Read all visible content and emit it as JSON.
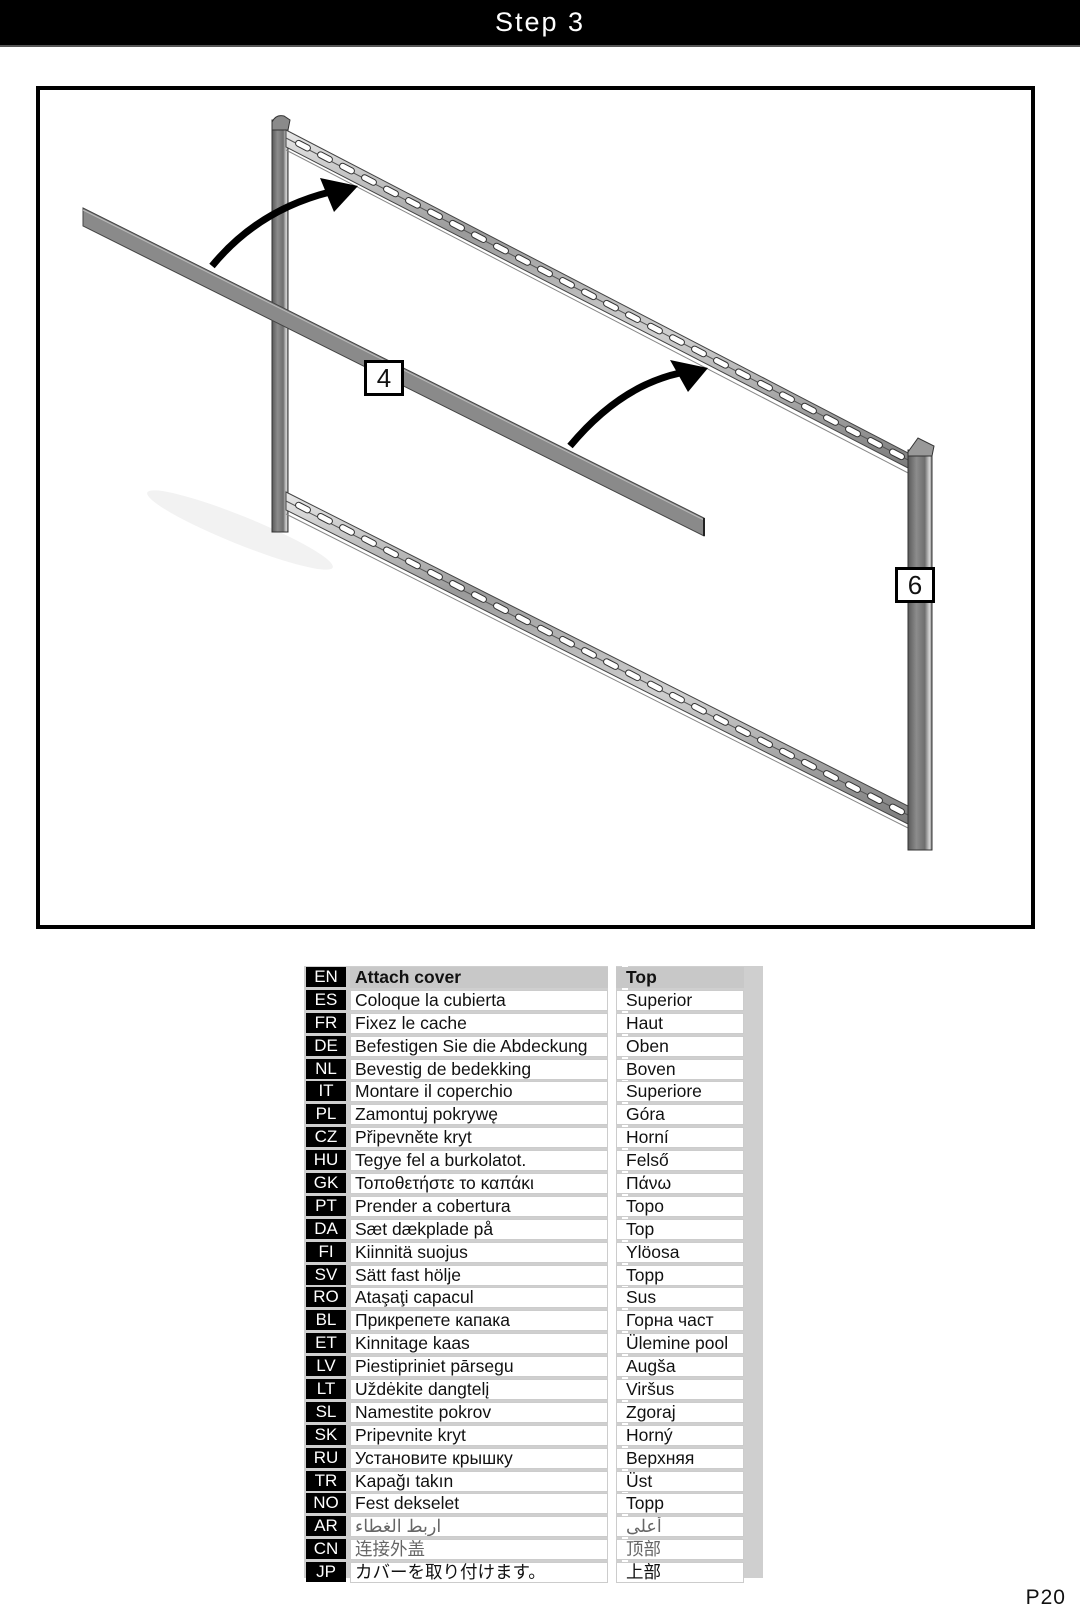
{
  "header": {
    "title": "Step 3"
  },
  "figure": {
    "callouts": [
      {
        "label": "4",
        "part": "cover"
      },
      {
        "label": "6",
        "part": "frame"
      }
    ],
    "icons": [
      "curved-arrow-icon",
      "curved-arrow-icon"
    ]
  },
  "translations": [
    {
      "code": "EN",
      "action": "Attach cover",
      "position": "Top"
    },
    {
      "code": "ES",
      "action": "Coloque la cubierta",
      "position": "Superior"
    },
    {
      "code": "FR",
      "action": "Fixez le cache",
      "position": "Haut"
    },
    {
      "code": "DE",
      "action": "Befestigen Sie die Abdeckung",
      "position": "Oben"
    },
    {
      "code": "NL",
      "action": "Bevestig de bedekking",
      "position": "Boven"
    },
    {
      "code": "IT",
      "action": "Montare il coperchio",
      "position": "Superiore"
    },
    {
      "code": "PL",
      "action": "Zamontuj pokrywę",
      "position": "Góra"
    },
    {
      "code": "CZ",
      "action": "Připevněte kryt",
      "position": "Horní"
    },
    {
      "code": "HU",
      "action": "Tegye fel a burkolatot.",
      "position": "Felső"
    },
    {
      "code": "GK",
      "action": "Τοποθετήστε το καπάκι",
      "position": "Πάνω"
    },
    {
      "code": "PT",
      "action": "Prender a cobertura",
      "position": "Topo"
    },
    {
      "code": "DA",
      "action": "Sæt dækplade på",
      "position": "Top"
    },
    {
      "code": "FI",
      "action": "Kiinnitä suojus",
      "position": "Ylöosa"
    },
    {
      "code": "SV",
      "action": "Sätt fast hölje",
      "position": "Topp"
    },
    {
      "code": "RO",
      "action": "Ataşaţi capacul",
      "position": "Sus"
    },
    {
      "code": "BL",
      "action": "Прикрепете капака",
      "position": "Горна част"
    },
    {
      "code": "ET",
      "action": "Kinnitage kaas",
      "position": "Ülemine pool"
    },
    {
      "code": "LV",
      "action": "Piestipriniet pārsegu",
      "position": "Augša"
    },
    {
      "code": "LT",
      "action": "Uždėkite dangtelį",
      "position": "Viršus"
    },
    {
      "code": "SL",
      "action": "Namestite pokrov",
      "position": "Zgoraj"
    },
    {
      "code": "SK",
      "action": "Pripevnite kryt",
      "position": "Horný"
    },
    {
      "code": "RU",
      "action": "Установите крышку",
      "position": "Верхняя"
    },
    {
      "code": "TR",
      "action": "Kapağı takın",
      "position": "Üst"
    },
    {
      "code": "NO",
      "action": "Fest dekselet",
      "position": "Topp"
    },
    {
      "code": "AR",
      "action": "اربط الغطاء",
      "position": "أعلى"
    },
    {
      "code": "CN",
      "action": "连接外盖",
      "position": "顶部"
    },
    {
      "code": "JP",
      "action": "カバーを取り付けます。",
      "position": "上部"
    }
  ],
  "footer": {
    "page_number": "P20"
  }
}
